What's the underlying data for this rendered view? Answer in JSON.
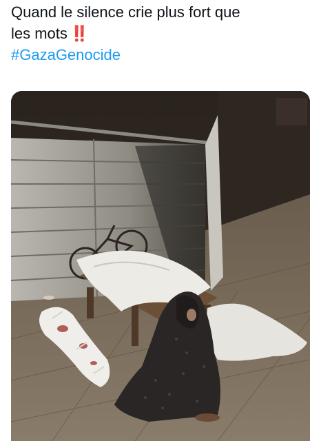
{
  "post": {
    "text_line1": "Quand le silence crie plus fort que",
    "text_line2": "les mots",
    "emphasis_glyph": "‼️",
    "hashtag": "#GazaGenocide"
  },
  "media": {
    "type": "photo"
  },
  "colors": {
    "text": "#0f1419",
    "link": "#1d9bf0",
    "emphasis": "#e0245e"
  }
}
